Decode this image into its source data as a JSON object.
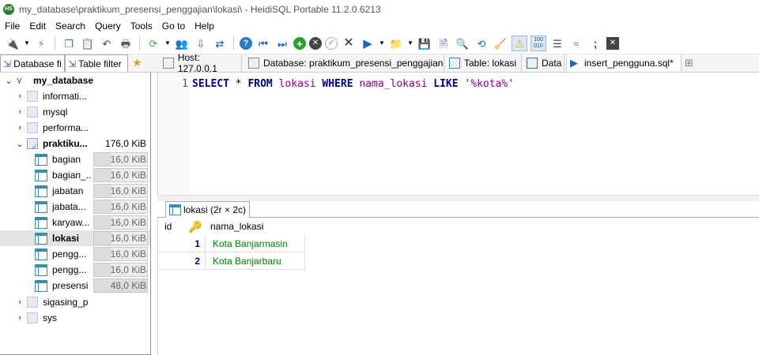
{
  "window": {
    "title": "my_database\\praktikum_presensi_penggajian\\lokasi\\ - HeidiSQL Portable 11.2.0.6213",
    "app_icon_text": "HS"
  },
  "menu": [
    "File",
    "Edit",
    "Search",
    "Query",
    "Tools",
    "Go to",
    "Help"
  ],
  "toolbar": {
    "icons": [
      "plug-icon",
      "dropdown-icon",
      "disconnect-icon",
      "copy-icon",
      "paste-icon",
      "undo-icon",
      "print-icon",
      "refresh-icon",
      "dropdown-icon",
      "user-manager-icon",
      "import-icon",
      "export-icon",
      "help-icon",
      "first-icon",
      "last-icon",
      "insert-icon",
      "cancel-icon",
      "post-icon",
      "delete-icon",
      "run-icon",
      "dropdown-icon",
      "open-file-icon",
      "dropdown-icon",
      "save-icon",
      "save-as-icon",
      "find-icon",
      "replace-icon",
      "clean-icon",
      "warning-icon",
      "binary-icon",
      "wrap-icon",
      "format-icon",
      "semicolon-icon",
      "close-icon"
    ]
  },
  "left_tabs": {
    "database_filter": "Database fi",
    "table_filter": "Table filter"
  },
  "right_tabs": [
    {
      "label": "Host: 127.0.0.1"
    },
    {
      "label": "Database: praktikum_presensi_penggajian"
    },
    {
      "label": "Table: lokasi"
    },
    {
      "label": "Data"
    },
    {
      "label": "insert_pengguna.sql*"
    }
  ],
  "tree": {
    "root": "my_database",
    "databases": [
      {
        "name": "informati..."
      },
      {
        "name": "mysql"
      },
      {
        "name": "performa..."
      },
      {
        "name": "praktiku...",
        "size": "176,0 KiB"
      },
      {
        "name": "sigasing_p"
      },
      {
        "name": "sys"
      }
    ],
    "tables": [
      {
        "name": "bagian",
        "size": "16,0 KiB",
        "fill": 0.33
      },
      {
        "name": "bagian_...",
        "size": "16,0 KiB",
        "fill": 0.33
      },
      {
        "name": "jabatan",
        "size": "16,0 KiB",
        "fill": 0.33
      },
      {
        "name": "jabata...",
        "size": "16,0 KiB",
        "fill": 0.33
      },
      {
        "name": "karyaw...",
        "size": "16,0 KiB",
        "fill": 0.33
      },
      {
        "name": "lokasi",
        "size": "16,0 KiB",
        "fill": 0.33,
        "selected": true
      },
      {
        "name": "pengg...",
        "size": "16,0 KiB",
        "fill": 0.33
      },
      {
        "name": "pengg...",
        "size": "16,0 KiB",
        "fill": 0.33
      },
      {
        "name": "presensi",
        "size": "48,0 KiB",
        "fill": 1.0
      }
    ]
  },
  "editor": {
    "line_number": "1",
    "tokens": [
      {
        "t": "SELECT",
        "c": "kw"
      },
      {
        "t": " * ",
        "c": ""
      },
      {
        "t": "FROM",
        "c": "kw"
      },
      {
        "t": " ",
        "c": ""
      },
      {
        "t": "lokasi",
        "c": "id"
      },
      {
        "t": " ",
        "c": ""
      },
      {
        "t": "WHERE",
        "c": "kw"
      },
      {
        "t": " ",
        "c": ""
      },
      {
        "t": "nama_lokasi",
        "c": "id"
      },
      {
        "t": " ",
        "c": ""
      },
      {
        "t": "LIKE",
        "c": "kw"
      },
      {
        "t": " ",
        "c": ""
      },
      {
        "t": "'%kota%'",
        "c": "str"
      }
    ]
  },
  "results": {
    "tab_label": "lokasi (2r × 2c)",
    "columns": [
      "id",
      "nama_lokasi"
    ],
    "rows": [
      [
        "1",
        "Kota Banjarmasin"
      ],
      [
        "2",
        "Kota Banjarbaru"
      ]
    ]
  },
  "colors": {
    "keyword": "#00008b",
    "identifier": "#8b008b",
    "id_value": "#00008b",
    "text_value": "#008000",
    "selected_row": "#e4e4e4"
  }
}
